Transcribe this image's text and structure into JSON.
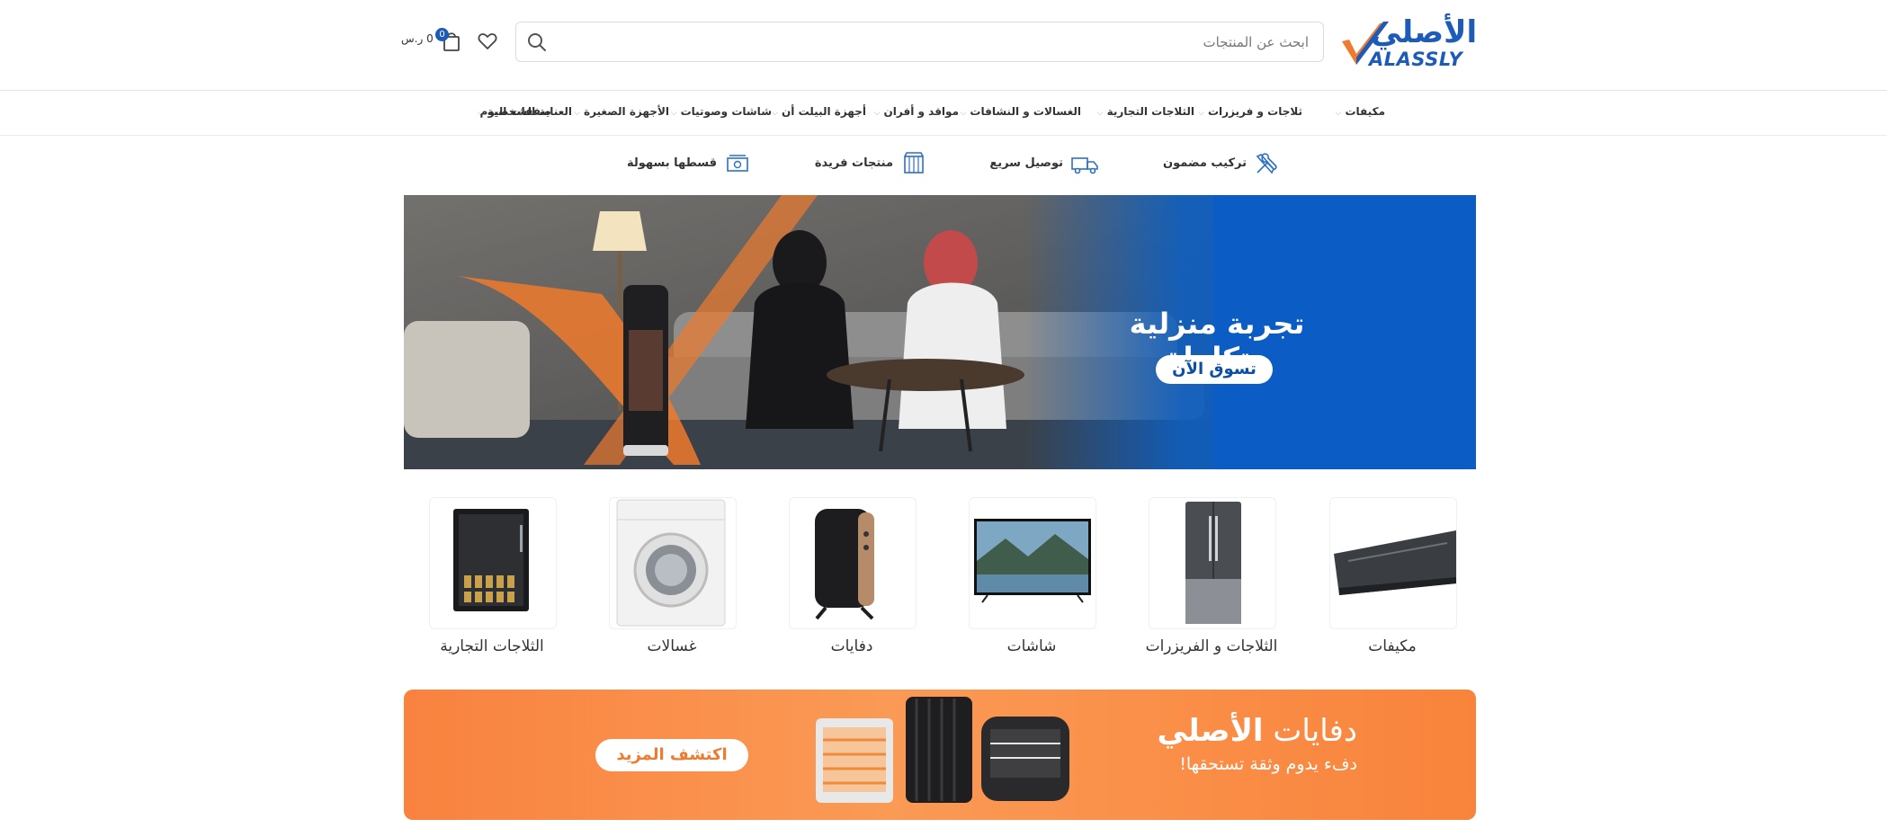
{
  "header": {
    "logo_ar": "الأصلي",
    "logo_en": "ALASSLY",
    "search_placeholder": "ابحث عن المنتجات",
    "cart_count": "0",
    "cart_total": "0 ر.س"
  },
  "nav": {
    "items": [
      {
        "label": "مكيفات",
        "has_dropdown": true
      },
      {
        "label": "ثلاجات و فريزرات",
        "has_dropdown": true
      },
      {
        "label": "الثلاجات التجارية",
        "has_dropdown": true
      },
      {
        "label": "الغسالات و النشافات",
        "has_dropdown": true
      },
      {
        "label": "مواقد و أفران",
        "has_dropdown": true
      },
      {
        "label": "أجهزة البيلت أن",
        "has_dropdown": true
      },
      {
        "label": "شاشات وصوتيات",
        "has_dropdown": true
      },
      {
        "label": "الأجهزة الصغيرة",
        "has_dropdown": true
      },
      {
        "label": "العناية الشخصية",
        "has_dropdown": true
      },
      {
        "label": "صفقات اليوم",
        "has_dropdown": false
      }
    ]
  },
  "features": [
    {
      "label": "تركيب مضمون",
      "icon": "tools-icon"
    },
    {
      "label": "توصيل سريع",
      "icon": "truck-icon"
    },
    {
      "label": "منتجات فريدة",
      "icon": "store-icon"
    },
    {
      "label": "قسطها بسهولة",
      "icon": "cash-icon"
    }
  ],
  "hero": {
    "headline": "تجربة منزلية متكاملة",
    "cta": "تسوق الآن",
    "accent_color": "#0d5fc2"
  },
  "categories": [
    {
      "label": "مكيفات",
      "icon": "air-conditioner"
    },
    {
      "label": "الثلاجات و الفريزرات",
      "icon": "refrigerator"
    },
    {
      "label": "شاشات",
      "icon": "television"
    },
    {
      "label": "دفايات",
      "icon": "oil-heater"
    },
    {
      "label": "غسالات",
      "icon": "washing-machine"
    },
    {
      "label": "الثلاجات التجارية",
      "icon": "beverage-cooler"
    }
  ],
  "promo": {
    "title_light": "دفايات",
    "title_bold": "الأصلي",
    "subtitle": "دفء يدوم وثقة تستحقها!",
    "cta": "اكتشف المزيد",
    "color": "#f9823f"
  }
}
